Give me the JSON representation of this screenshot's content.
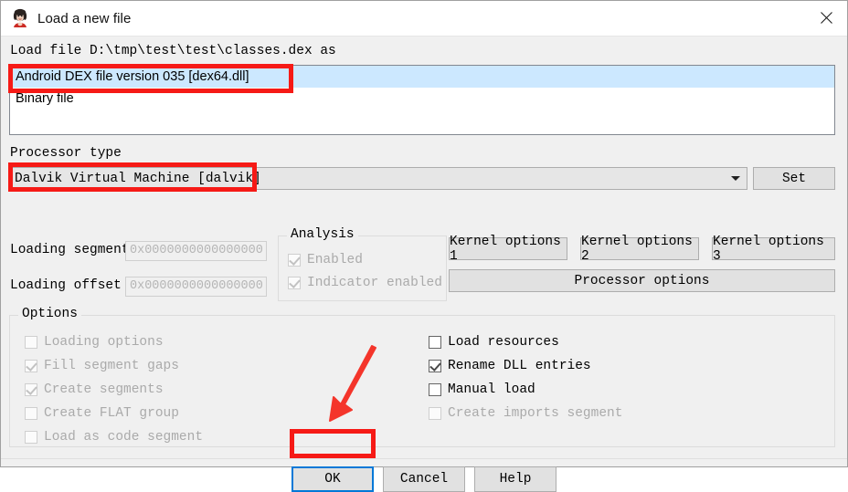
{
  "window": {
    "title": "Load a new file",
    "icon": "ida-logo-icon",
    "close_icon": "close-icon"
  },
  "file_label": "Load file D:\\tmp\\test\\test\\classes.dex as",
  "loader_list": {
    "items": [
      {
        "label": "Android DEX file version 035 [dex64.dll]",
        "selected": true
      },
      {
        "label": "Binary file",
        "selected": false
      }
    ]
  },
  "processor": {
    "label": "Processor type",
    "selected": "Dalvik Virtual Machine [dalvik]",
    "dropdown_icon": "chevron-down-icon",
    "set_button": "Set"
  },
  "loading": {
    "segment_label": "Loading segment",
    "segment_value": "0x0000000000000000",
    "offset_label": "Loading offset",
    "offset_value": "0x0000000000000000"
  },
  "analysis": {
    "title": "Analysis",
    "items": [
      {
        "label": "Enabled",
        "checked": true,
        "disabled": true
      },
      {
        "label": "Indicator enabled",
        "checked": true,
        "disabled": true
      }
    ]
  },
  "kernel_buttons": [
    "Kernel options 1",
    "Kernel options 2",
    "Kernel options 3"
  ],
  "processor_options_button": "Processor options",
  "options": {
    "title": "Options",
    "left": [
      {
        "label": "Loading options",
        "checked": false,
        "disabled": true
      },
      {
        "label": "Fill segment gaps",
        "checked": true,
        "disabled": true
      },
      {
        "label": "Create segments",
        "checked": true,
        "disabled": true
      },
      {
        "label": "Create FLAT group",
        "checked": false,
        "disabled": true
      },
      {
        "label": "Load as code segment",
        "checked": false,
        "disabled": true
      }
    ],
    "right": [
      {
        "label": "Load resources",
        "checked": false,
        "disabled": false
      },
      {
        "label": "Rename DLL entries",
        "checked": true,
        "disabled": false
      },
      {
        "label": "Manual load",
        "checked": false,
        "disabled": false
      },
      {
        "label": "Create imports segment",
        "checked": false,
        "disabled": true
      }
    ]
  },
  "footer": {
    "ok": "OK",
    "cancel": "Cancel",
    "help": "Help"
  },
  "annotations": {
    "highlight_color": "#f61a16",
    "focus_color": "#0078d7",
    "arrow": "red-arrow-pointing-to-ok-button"
  }
}
